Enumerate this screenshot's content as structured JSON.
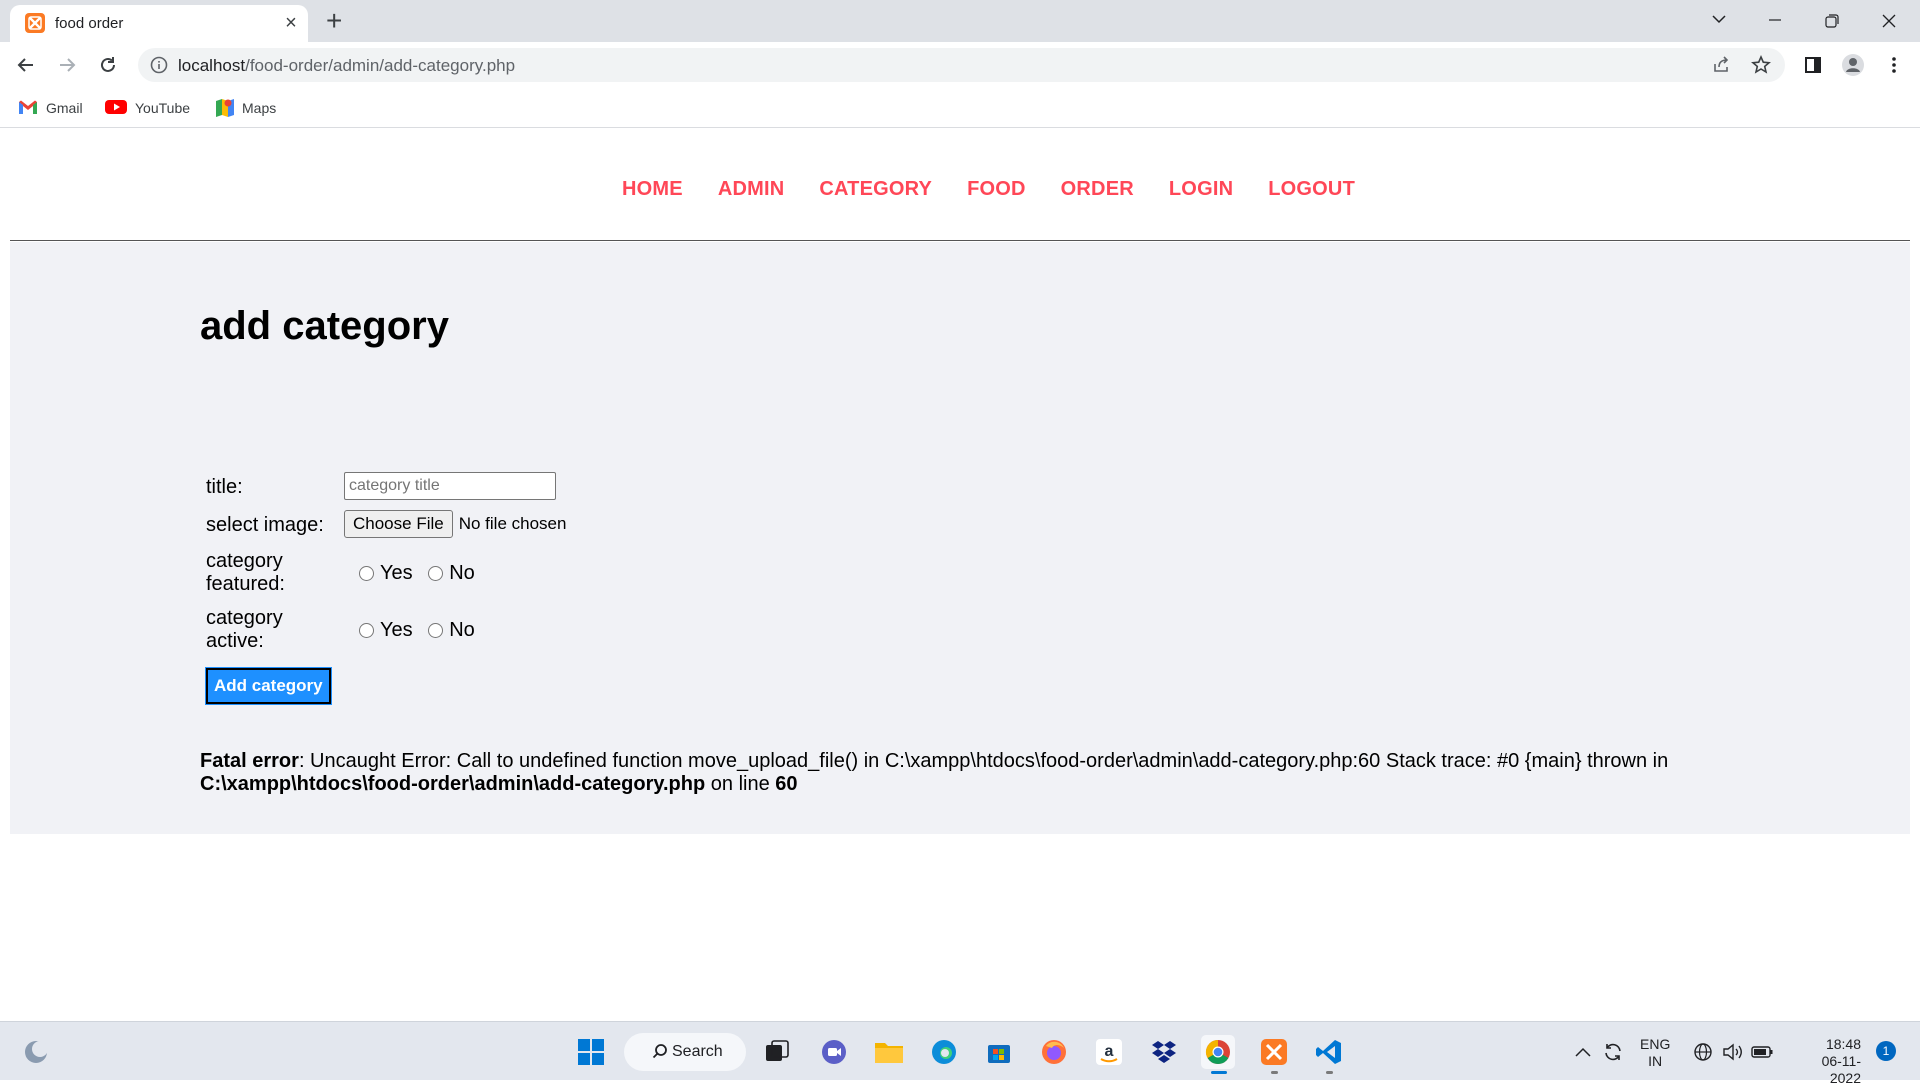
{
  "browser": {
    "tab_title": "food order",
    "url_host": "localhost",
    "url_path": "/food-order/admin/add-category.php"
  },
  "bookmarks": [
    {
      "label": "Gmail"
    },
    {
      "label": "YouTube"
    },
    {
      "label": "Maps"
    }
  ],
  "menu": {
    "items": [
      "HOME",
      "ADMIN",
      "CATEGORY",
      "FOOD",
      "ORDER",
      "LOGIN",
      "LOGOUT"
    ]
  },
  "main": {
    "heading": "add category",
    "form": {
      "title_label": "title:",
      "title_placeholder": "category title",
      "image_label": "select image:",
      "choose_file_label": "Choose File",
      "no_file_label": "No file chosen",
      "featured_label_1": "category",
      "featured_label_2": "featured:",
      "active_label_1": "category",
      "active_label_2": "active:",
      "yes_label": "Yes",
      "no_label": "No",
      "submit_label": "Add category"
    },
    "error": {
      "prefix": "Fatal error",
      "message": ": Uncaught Error: Call to undefined function move_upload_file() in C:\\xampp\\htdocs\\food-order\\admin\\add-category.php:60 Stack trace: #0 {main} thrown in",
      "file": "C:\\xampp\\htdocs\\food-order\\admin\\add-category.php",
      "on_line": " on line ",
      "line": "60"
    }
  },
  "taskbar": {
    "search_label": "Search",
    "lang_1": "ENG",
    "lang_2": "IN",
    "time": "18:48",
    "date": "06-11-2022",
    "notification_count": "1"
  },
  "colors": {
    "menu_link": "#ff4757",
    "content_bg": "#f1f2f6",
    "button_bg": "#1e90ff"
  }
}
